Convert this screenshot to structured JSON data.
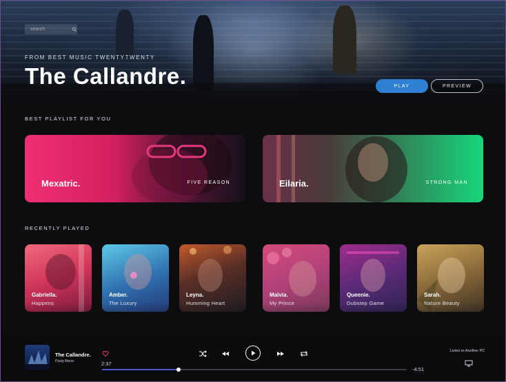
{
  "search": {
    "placeholder": "search"
  },
  "hero": {
    "kicker": "FROM BEST MUSIC TWENTYTWENTY",
    "title": "The Callandre.",
    "play_label": "PLAY",
    "preview_label": "PREVIEW"
  },
  "playlists": {
    "heading": "BEST PLAYLIST FOR YOU",
    "items": [
      {
        "name": "Mexatric.",
        "subtitle": "FIVE REASON"
      },
      {
        "name": "Eilaria.",
        "subtitle": "STRONG MAN"
      }
    ]
  },
  "recent": {
    "heading": "RECENTLY PLAYED",
    "items": [
      {
        "artist": "Gabriella.",
        "song": "Happens"
      },
      {
        "artist": "Amber.",
        "song": "The Luxury"
      },
      {
        "artist": "Leyna.",
        "song": "Humming Heart"
      },
      {
        "artist": "Malvia.",
        "song": "My Prince"
      },
      {
        "artist": "Queenie.",
        "song": "Dubstep Game"
      },
      {
        "artist": "Sarah.",
        "song": "Nature Beauty"
      }
    ]
  },
  "player": {
    "title": "The Callandre.",
    "artist": "Party Bene",
    "current_time": "2:37",
    "remaining_time": "-4:51",
    "progress": 0.25,
    "listen_label": "Listen to Another PC",
    "icons": [
      "heart-icon",
      "shuffle-icon",
      "rewind-icon",
      "play-icon",
      "fast-forward-icon",
      "repeat-icon",
      "monitor-icon"
    ]
  },
  "colors": {
    "accent": "#2f7fd3",
    "progress": "#4c59c9",
    "heart": "#e8385a"
  }
}
